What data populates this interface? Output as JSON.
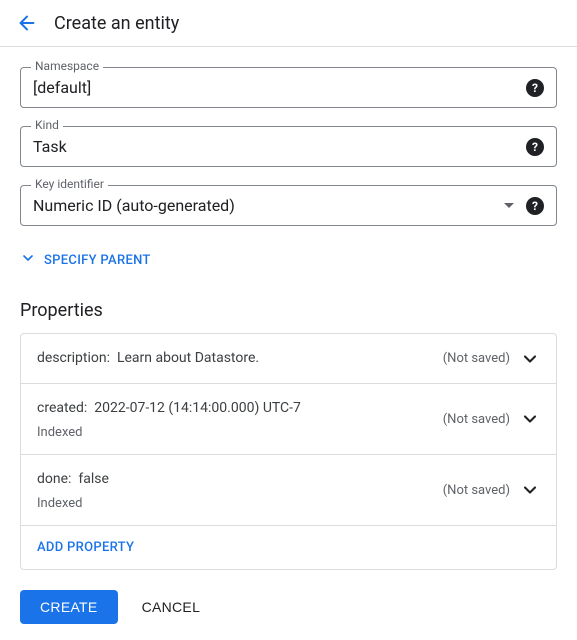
{
  "header": {
    "title": "Create an entity"
  },
  "fields": {
    "namespace": {
      "label": "Namespace",
      "value": "[default]"
    },
    "kind": {
      "label": "Kind",
      "value": "Task"
    },
    "keyIdentifier": {
      "label": "Key identifier",
      "value": "Numeric ID (auto-generated)"
    }
  },
  "specifyParent": "SPECIFY PARENT",
  "propertiesTitle": "Properties",
  "notSavedLabel": "(Not saved)",
  "indexedLabel": "Indexed",
  "properties": [
    {
      "name": "description",
      "value": "Learn about Datastore.",
      "indexed": false
    },
    {
      "name": "created",
      "value": "2022-07-12 (14:14:00.000) UTC-7",
      "indexed": true
    },
    {
      "name": "done",
      "value": "false",
      "indexed": true
    }
  ],
  "addProperty": "ADD PROPERTY",
  "buttons": {
    "create": "CREATE",
    "cancel": "CANCEL"
  }
}
